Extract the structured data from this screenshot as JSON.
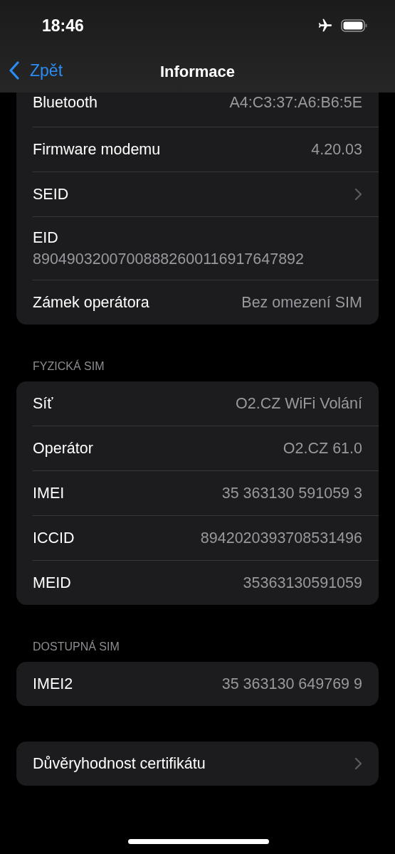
{
  "status_bar": {
    "time": "18:46",
    "airplane_mode": true
  },
  "nav": {
    "back_label": "Zpět",
    "title": "Informace"
  },
  "sections": [
    {
      "cut_top": true,
      "rows": [
        {
          "kind": "value",
          "label": "Bluetooth",
          "value": "A4:C3:37:A6:B6:5E"
        },
        {
          "kind": "value",
          "label": "Firmware modemu",
          "value": "4.20.03"
        },
        {
          "kind": "chevron",
          "label": "SEID"
        },
        {
          "kind": "stacked",
          "label": "EID",
          "value": "89049032007008882600116917647892"
        },
        {
          "kind": "value",
          "label": "Zámek operátora",
          "value": "Bez omezení SIM"
        }
      ]
    },
    {
      "header": "FYZICKÁ SIM",
      "rows": [
        {
          "kind": "value",
          "label": "Síť",
          "value": "O2.CZ WiFi Volání"
        },
        {
          "kind": "value",
          "label": "Operátor",
          "value": "O2.CZ 61.0"
        },
        {
          "kind": "value",
          "label": "IMEI",
          "value": "35 363130 591059 3"
        },
        {
          "kind": "value",
          "label": "ICCID",
          "value": "8942020393708531496"
        },
        {
          "kind": "value",
          "label": "MEID",
          "value": "35363130591059"
        }
      ]
    },
    {
      "header": "DOSTUPNÁ SIM",
      "rows": [
        {
          "kind": "value",
          "label": "IMEI2",
          "value": "35 363130 649769 9"
        }
      ]
    },
    {
      "rows": [
        {
          "kind": "chevron",
          "label": "Důvěryhodnost certifikátu"
        }
      ]
    }
  ]
}
